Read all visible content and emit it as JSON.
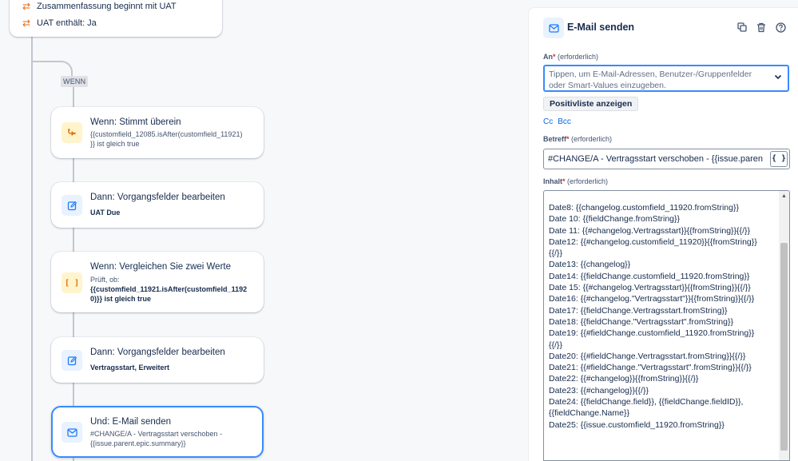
{
  "flow": {
    "top_card": {
      "row1": "Zusammenfassung beginnt mit UAT",
      "row2": "UAT enthält: Ja"
    },
    "branch_badge": "WENN",
    "nodes": [
      {
        "title": "Wenn: Stimmt überein",
        "sub_line1": "{{customfield_12085.isAfter(customfield_11921)",
        "sub_line2": "}} ist gleich true",
        "icon": "branch-icon"
      },
      {
        "title": "Dann: Vorgangsfelder bearbeiten",
        "sub_bold": "UAT Due",
        "icon": "edit-icon"
      },
      {
        "title": "Wenn: Vergleichen Sie zwei Werte",
        "sub_line1": "Prüft, ob:",
        "sub_bold1": "{{customfield_11921.isAfter(customfield_1192",
        "sub_bold2": "0)}} ist gleich true",
        "icon": "compare-icon"
      },
      {
        "title": "Dann: Vorgangsfelder bearbeiten",
        "sub_bold": "Vertragsstart, Erweitert",
        "icon": "edit-icon"
      },
      {
        "title": "Und: E-Mail senden",
        "sub_line1": "#CHANGE/A - Vertragsstart verschoben -",
        "sub_line2": "{{issue.parent.epic.summary}}",
        "icon": "mail-icon"
      }
    ]
  },
  "panel": {
    "title": "E-Mail senden",
    "to": {
      "label": "An",
      "req_mark": "*",
      "hint": "(erforderlich)",
      "placeholder_line1": "Tippen, um E-Mail-Adressen, Benutzer-/Gruppenfelder",
      "placeholder_line2": "oder Smart-Values einzugeben."
    },
    "allowlist_button": "Positivliste anzeigen",
    "cc_label": "Cc",
    "bcc_label": "Bcc",
    "subject": {
      "label": "Betreff",
      "req_mark": "*",
      "hint": "(erforderlich)",
      "value": "#CHANGE/A - Vertragsstart verschoben - {{issue.paren",
      "smart_button": "{ }"
    },
    "body": {
      "label": "Inhalt",
      "req_mark": "*",
      "hint": "(erforderlich)",
      "lines": [
        "Date8: {{changelog.customfield_11920.fromString}}",
        "Date 10: {{fieldChange.fromString}}",
        "Date 11: {{#changelog.Vertragsstart}}{{fromString}}{{/}}",
        "Date12: {{#changelog.customfield_11920}}{{fromString}}",
        "{{/}}",
        "Date13: {{changelog}}",
        "Date14: {{fieldChange.customfield_11920.fromString}}",
        "Date 15: {{#changelog.Vertragsstart}}{{fromString}}{{/}}",
        "Date16: {{#changelog.\"Vertragsstart\"}}{{fromString}}{{/}}",
        "Date17: {{fieldChange.Vertragsstart.fromString}}",
        "Date18: {{fieldChange.\"Vertragsstart\".fromString}}",
        "Date19: {{#fieldChange.customfield_11920.fromString}}",
        "{{/}}",
        "Date20: {{#fieldChange.Vertragsstart.fromString}}{{/}}",
        "Date21: {{#fieldChange.\"Vertragsstart\".fromString}}{{/}}",
        "Date22: {{#changelog}}{{fromString}}{{/}}",
        "Date23: {{#changelog}}{{/}}",
        "Date24: {{fieldChange.field}}, {{fieldChange.fieldID}},",
        "{{fieldChange.Name}}",
        "Date25: {{issue.customfield_11920.fromString}}"
      ]
    }
  },
  "colors": {
    "accent": "#1d7afc",
    "selected_border": "#388bff",
    "required": "#c9372c",
    "condition_icon_bg": "#fff4cc"
  }
}
